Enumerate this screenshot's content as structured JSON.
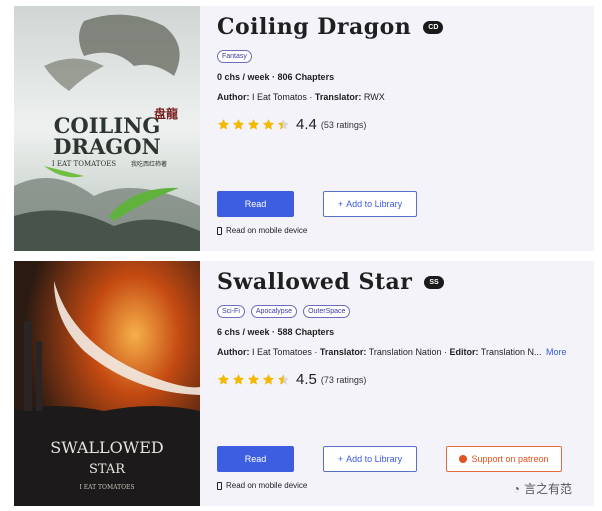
{
  "novels": [
    {
      "title": "Coiling Dragon",
      "abbr": "CD",
      "tags": [
        "Fantasy"
      ],
      "chs_per_week": "0 chs / week",
      "chapters": "806 Chapters",
      "author_label": "Author:",
      "author": "I Eat Tomatos",
      "translator_label": "Translator:",
      "translator": "RWX",
      "rating": 4.4,
      "rating_text": "4.4",
      "ratings_count": "(53 ratings)",
      "read_label": "Read",
      "library_label": "Add to Library",
      "mobile_label": "Read on mobile device",
      "cover": {
        "title_line1": "COILING",
        "title_line2": "DRAGON",
        "title_cjk": "盘龍",
        "subtitle": "I EAT TOMATOES",
        "subtitle_cjk": "我吃西红柿著"
      }
    },
    {
      "title": "Swallowed Star",
      "abbr": "SS",
      "tags": [
        "Sci-Fi",
        "Apocalypse",
        "OuterSpace"
      ],
      "chs_per_week": "6 chs / week",
      "chapters": "588 Chapters",
      "author_label": "Author:",
      "author": "I Eat Tomatoes",
      "translator_label": "Translator:",
      "translator": "Translation Nation",
      "editor_label": "Editor:",
      "editor": "Translation N...",
      "more_label": "More",
      "rating": 4.5,
      "rating_text": "4.5",
      "ratings_count": "(73 ratings)",
      "read_label": "Read",
      "library_label": "Add to Library",
      "patreon_label": "Support on patreon",
      "mobile_label": "Read on mobile device",
      "cover": {
        "title_line1": "SWALLOWED",
        "title_line2": "STAR",
        "subtitle": "I EAT TOMATOES"
      }
    }
  ],
  "watermark": "言之有范",
  "colors": {
    "accent": "#3d5ee0",
    "star": "#f5b800",
    "patreon": "#e0541f"
  }
}
